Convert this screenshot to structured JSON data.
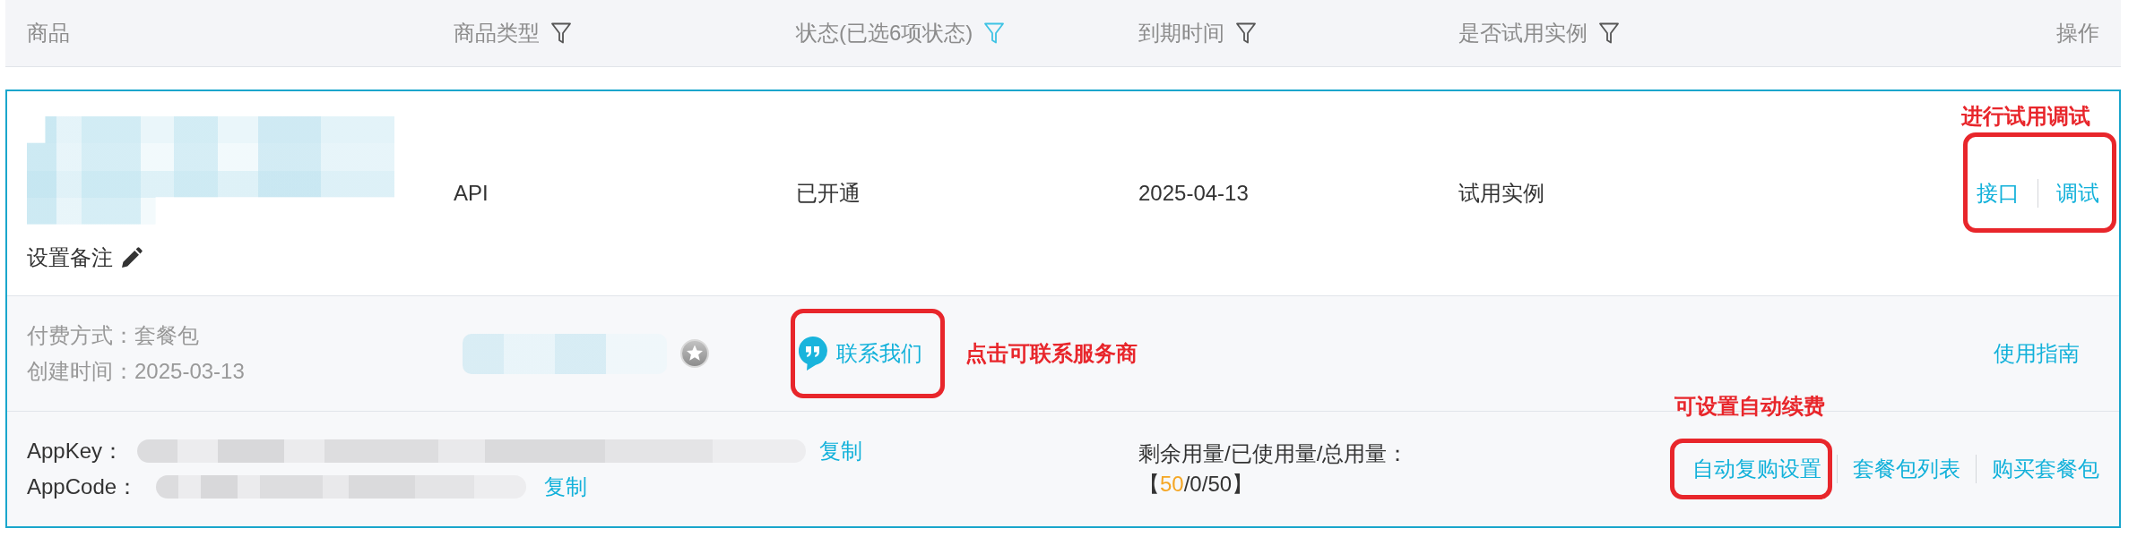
{
  "table": {
    "columns": [
      {
        "label": "商品"
      },
      {
        "label": "商品类型",
        "filter": {
          "active": false
        }
      },
      {
        "label": "状态(已选6项状态)",
        "filter": {
          "active": true
        }
      },
      {
        "label": "到期时间",
        "filter": {
          "active": false
        }
      },
      {
        "label": "是否试用实例",
        "filter": {
          "active": false
        }
      },
      {
        "label": "操作"
      }
    ],
    "rows": [
      {
        "note_button": "设置备注",
        "type": "API",
        "status": "已开通",
        "expiry": "2025-04-13",
        "trial": "试用实例",
        "actions": {
          "items": [
            "接口",
            "调试"
          ],
          "annotation": "进行试用调试"
        },
        "details": {
          "payment": "付费方式：套餐包",
          "created": "创建时间：2025-03-13",
          "contact": {
            "label": "联系我们",
            "annotation": "点击可联系服务商"
          },
          "guide": "使用指南"
        },
        "credentials": [
          {
            "label": "AppKey：",
            "copy": "复制"
          },
          {
            "label": "AppCode：",
            "copy": "复制"
          }
        ],
        "usage": {
          "label": "剩余用量/已使用量/总用量：",
          "parts": [
            {
              "kind": "plain",
              "text": "【"
            },
            {
              "kind": "remaining",
              "text": "50"
            },
            {
              "kind": "plain",
              "text": "/0/50】"
            }
          ]
        },
        "package_actions": [
          {
            "label": "自动复购设置",
            "annotation": "可设置自动续费"
          },
          {
            "label": "套餐包列表"
          },
          {
            "label": "购买套餐包"
          }
        ]
      }
    ]
  }
}
